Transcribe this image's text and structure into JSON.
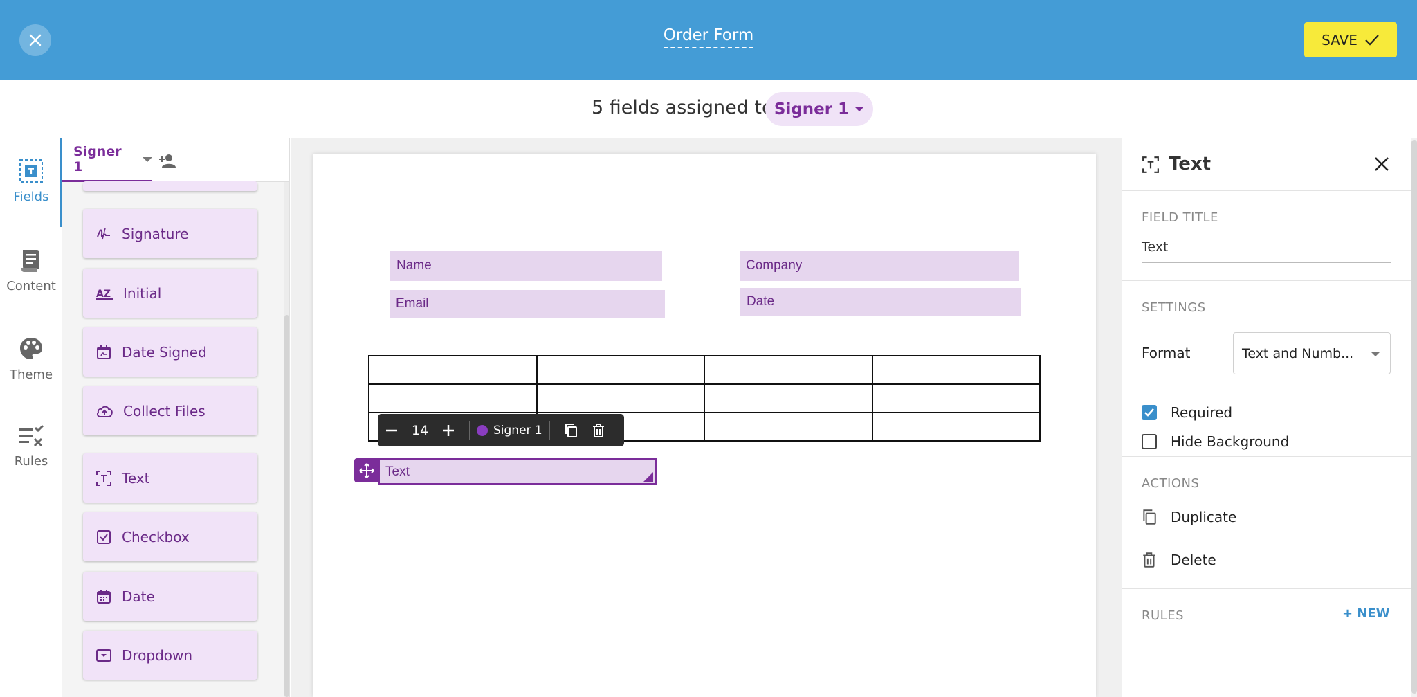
{
  "topbar": {
    "title": "Order Form",
    "save_label": "SAVE",
    "bg": "#449cd6",
    "save_bg": "#f7ea3a"
  },
  "subbar": {
    "assign_text": "5 fields assigned to",
    "signer": "Signer 1"
  },
  "rail": {
    "items": [
      {
        "label": "Fields",
        "icon": "fields-icon",
        "active": true
      },
      {
        "label": "Content",
        "icon": "content-icon"
      },
      {
        "label": "Theme",
        "icon": "palette-icon"
      },
      {
        "label": "Rules",
        "icon": "rules-icon"
      }
    ]
  },
  "palette": {
    "signer_tab": "Signer 1",
    "fields": [
      {
        "label": "Signature",
        "icon": "signature-icon"
      },
      {
        "label": "Initial",
        "icon": "initial-icon"
      },
      {
        "label": "Date Signed",
        "icon": "date-signed-icon"
      },
      {
        "label": "Collect Files",
        "icon": "cloud-upload-icon"
      },
      {
        "label": "Text",
        "icon": "text-field-icon"
      },
      {
        "label": "Checkbox",
        "icon": "checkbox-icon"
      },
      {
        "label": "Date",
        "icon": "calendar-icon"
      },
      {
        "label": "Dropdown",
        "icon": "dropdown-icon"
      }
    ]
  },
  "document": {
    "fields": [
      {
        "label": "Name"
      },
      {
        "label": "Company"
      },
      {
        "label": "Email"
      },
      {
        "label": "Date"
      }
    ],
    "toolbar": {
      "font_size": "14",
      "signer": "Signer 1"
    },
    "selected_field": "Text"
  },
  "panel": {
    "title": "Text",
    "field_title_label": "FIELD TITLE",
    "field_title_value": "Text",
    "settings_label": "SETTINGS",
    "format_label": "Format",
    "format_value": "Text and Numb...",
    "required_label": "Required",
    "required": true,
    "hide_bg_label": "Hide Background",
    "hide_bg": false,
    "actions_label": "ACTIONS",
    "duplicate_label": "Duplicate",
    "delete_label": "Delete",
    "rules_label": "RULES",
    "new_label": "+ NEW"
  },
  "colors": {
    "accent_purple": "#7b2d9a",
    "field_fill": "#e6d6ee",
    "link_blue": "#3a8fcb"
  }
}
